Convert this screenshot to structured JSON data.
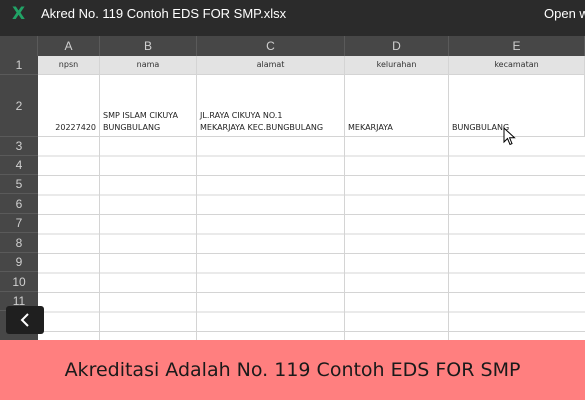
{
  "window": {
    "app_icon": "X",
    "file_title": "Akred No. 119 Contoh EDS FOR SMP.xlsx",
    "open_with": "Open w"
  },
  "sheet": {
    "columns": [
      "A",
      "B",
      "C",
      "D",
      "E"
    ],
    "rows": [
      "1",
      "2",
      "3",
      "4",
      "5",
      "6",
      "7",
      "8",
      "9",
      "10",
      "11"
    ],
    "header_cells": [
      "npsn",
      "nama",
      "alamat",
      "kelurahan",
      "kecamatan"
    ],
    "data_row": {
      "npsn": "20227420",
      "nama_line1": "SMP ISLAM CIKUYA",
      "nama_line2": "BUNGBULANG",
      "alamat_line1": "JL.RAYA CIKUYA NO.1",
      "alamat_line2": "MEKARJAYA KEC.BUNGBULANG",
      "kelurahan": "MEKARJAYA",
      "kecamatan": "BUNGBULANG"
    }
  },
  "navigation": {
    "back_icon": "chevron-left-icon"
  },
  "banner": {
    "text": "Akreditasi Adalah No. 119 Contoh EDS FOR SMP"
  },
  "colors": {
    "title_bar": "#2b2b2b",
    "header_bar": "#474747",
    "excel_green": "#21a366",
    "banner_bg": "#ff7f7f"
  }
}
